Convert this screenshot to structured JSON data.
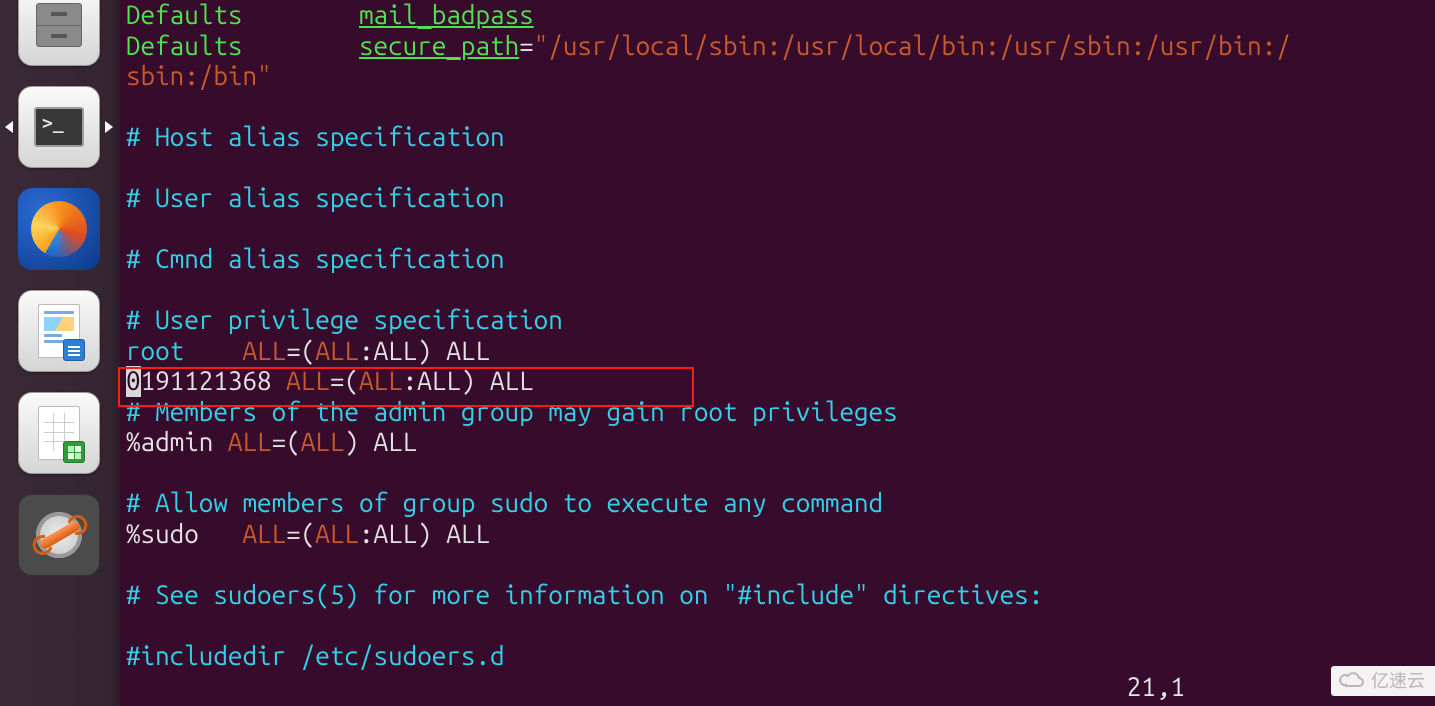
{
  "launcher": {
    "items": [
      {
        "name": "unknown-app-icon",
        "interact": true
      },
      {
        "name": "files-icon",
        "interact": true
      },
      {
        "name": "terminal-icon",
        "interact": true,
        "arrows": [
          "left",
          "right"
        ]
      },
      {
        "name": "firefox-icon",
        "interact": true
      },
      {
        "name": "writer-icon",
        "interact": true
      },
      {
        "name": "calc-icon",
        "interact": true
      },
      {
        "name": "settings-icon",
        "interact": true
      }
    ]
  },
  "editor": {
    "lines": {
      "l0_a": "Defaults",
      "l0_b": "mail_badpass",
      "l1_a": "Defaults",
      "l1_b": "secure_path",
      "l1_c": "=",
      "l1_d": "\"/usr/local/sbin:/usr/local/bin:/usr/sbin:/usr/bin:/",
      "l2": "sbin:/bin\"",
      "l3": "",
      "l4": "# Host alias specification",
      "l5": "",
      "l6": "# User alias specification",
      "l7": "",
      "l8": "# Cmnd alias specification",
      "l9": "",
      "l10": "# User privilege specification",
      "l11_a": "root",
      "l11_b": "ALL",
      "l11_c": "=(",
      "l11_d": "ALL",
      "l11_e": ":",
      "l11_f": "ALL) ALL",
      "l12_cur": "0",
      "l12_a": "191121368 ",
      "l12_b": "ALL",
      "l12_c": "=(",
      "l12_d": "ALL",
      "l12_e": ":",
      "l12_f": "ALL) ALL",
      "l13": "# Members of the admin group may gain root privileges",
      "l14_a": "%admin ",
      "l14_b": "ALL",
      "l14_c": "=(",
      "l14_d": "ALL",
      "l14_e": ") ",
      "l14_f": "ALL",
      "l15": "",
      "l16": "# Allow members of group sudo to execute any command",
      "l17_a": "%sudo   ",
      "l17_b": "ALL",
      "l17_c": "=(",
      "l17_d": "ALL",
      "l17_e": ":",
      "l17_f": "ALL) ALL",
      "l18": "",
      "l19": "# See sudoers(5) for more information on \"#include\" directives:",
      "l20": "",
      "l21": "#includedir /etc/sudoers.d"
    },
    "status_position": "21,1"
  },
  "annotation_box": true,
  "watermark": "亿速云"
}
